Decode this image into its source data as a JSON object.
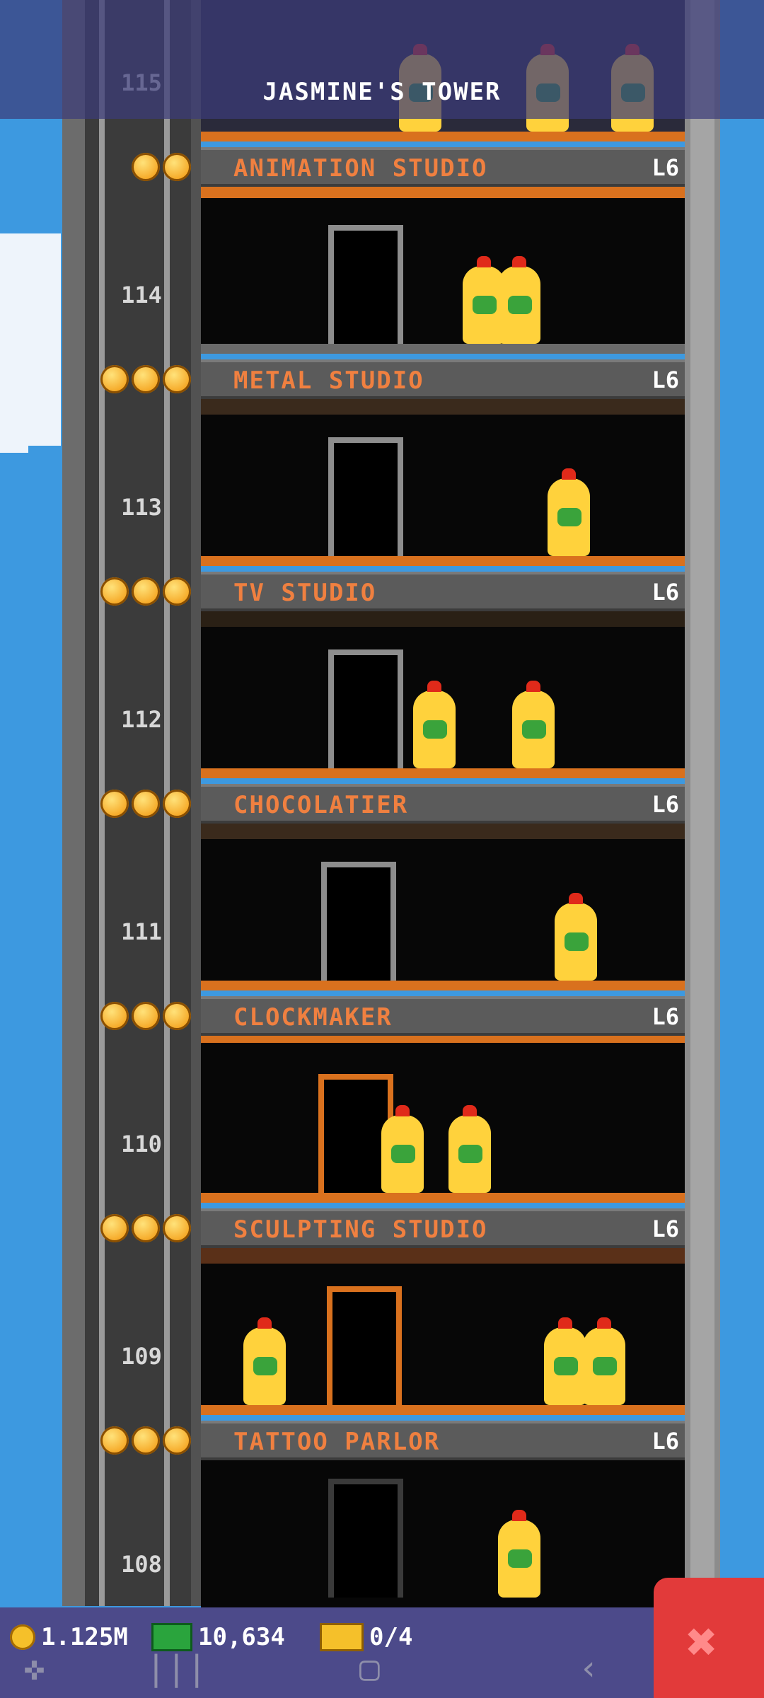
{
  "header": {
    "tower_title": "JASMINE'S TOWER"
  },
  "floors": [
    {
      "number": "115",
      "name": "",
      "level": ""
    },
    {
      "number": "114",
      "name": "ANIMATION STUDIO",
      "level": "L6"
    },
    {
      "number": "113",
      "name": "METAL STUDIO",
      "level": "L6"
    },
    {
      "number": "112",
      "name": "TV STUDIO",
      "level": "L6"
    },
    {
      "number": "111",
      "name": "CHOCOLATIER",
      "level": "L6"
    },
    {
      "number": "110",
      "name": "CLOCKMAKER",
      "level": "L6"
    },
    {
      "number": "109",
      "name": "SCULPTING STUDIO",
      "level": "L6"
    },
    {
      "number": "108",
      "name": "TATTOO PARLOR",
      "level": "L6"
    }
  ],
  "hud": {
    "coins": "1.125M",
    "bux": "10,634",
    "tickets": "0/4",
    "close_icon": "close-x-icon"
  },
  "colors": {
    "sky": "#3d99e0",
    "banner_text": "#f08040",
    "room_floor": "#d9711e",
    "hud_bg": "#4c4a8a",
    "close_button": "#e23a3a"
  }
}
